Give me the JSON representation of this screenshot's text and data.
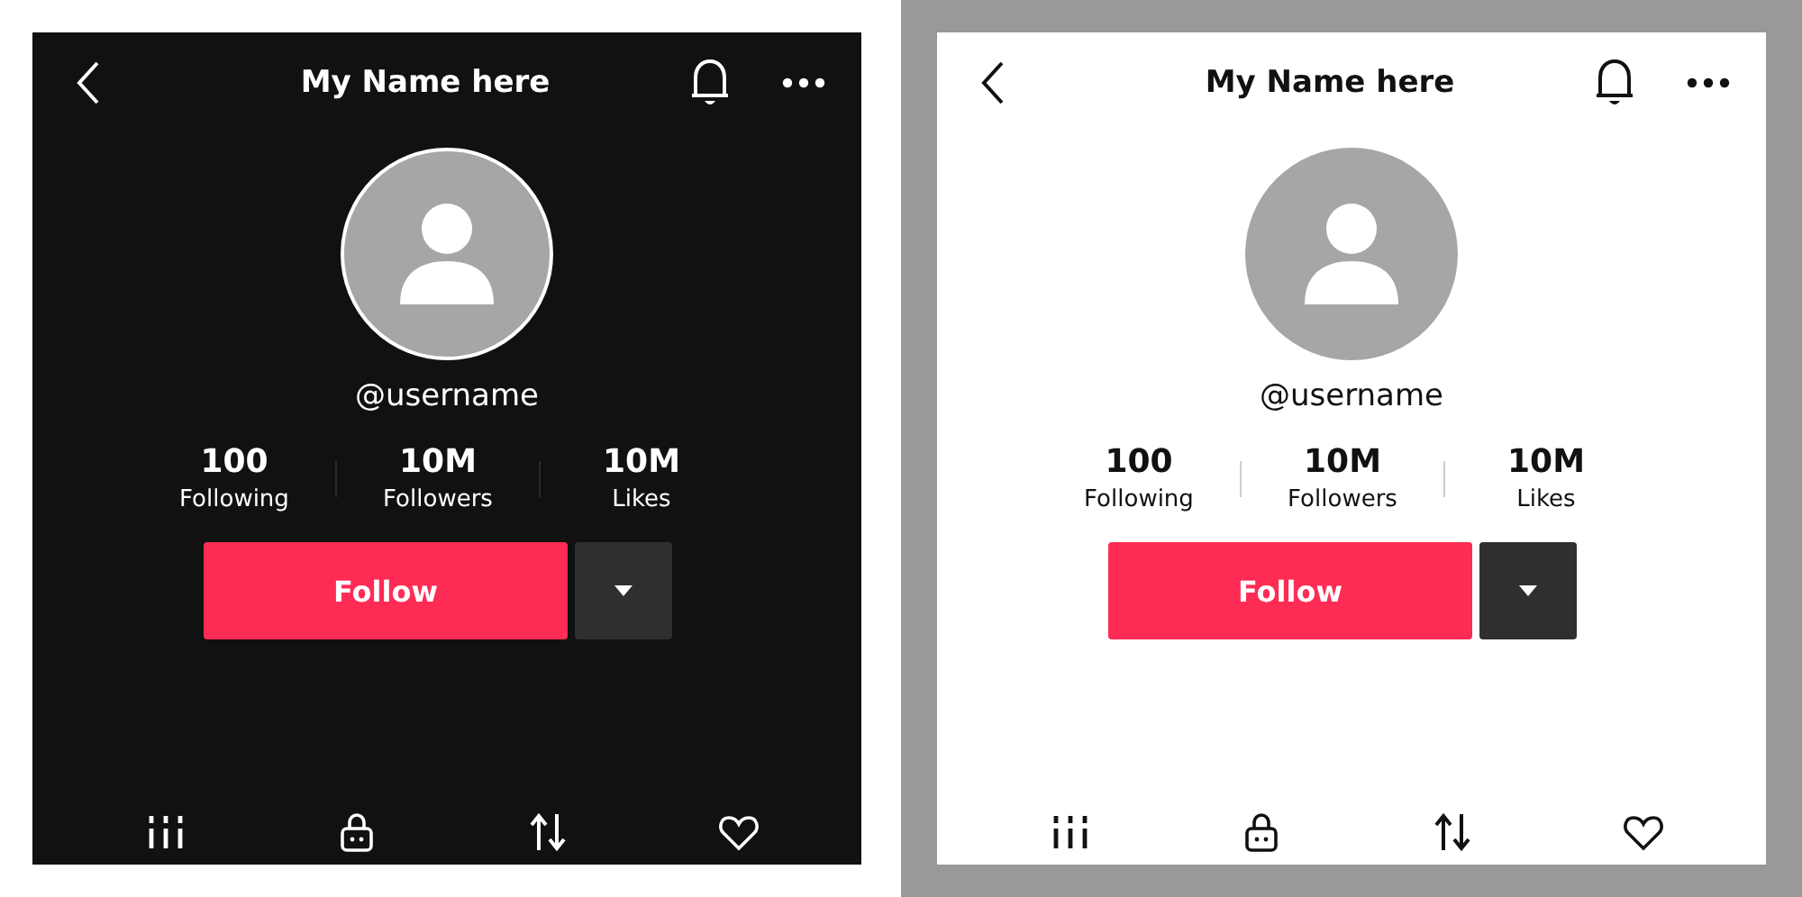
{
  "screens": [
    {
      "kind": "dark",
      "title": "My Name here",
      "username": "@username",
      "stats": [
        {
          "value": "100",
          "label": "Following"
        },
        {
          "value": "10M",
          "label": "Followers"
        },
        {
          "value": "10M",
          "label": "Likes"
        }
      ],
      "follow_button": "Follow"
    },
    {
      "kind": "light",
      "title": "My Name here",
      "username": "@username",
      "stats": [
        {
          "value": "100",
          "label": "Following"
        },
        {
          "value": "10M",
          "label": "Followers"
        },
        {
          "value": "10M",
          "label": "Likes"
        }
      ],
      "follow_button": "Follow"
    }
  ]
}
